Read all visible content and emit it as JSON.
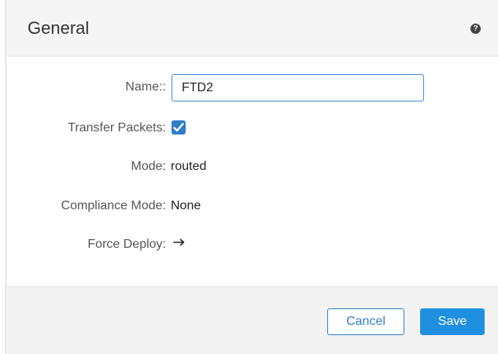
{
  "dialog": {
    "title": "General",
    "help_icon": "help-icon"
  },
  "form": {
    "name_label": "Name::",
    "name_value": "FTD2",
    "transfer_packets_label": "Transfer Packets:",
    "transfer_packets_checked": true,
    "mode_label": "Mode:",
    "mode_value": "routed",
    "compliance_mode_label": "Compliance Mode:",
    "compliance_mode_value": "None",
    "force_deploy_label": "Force Deploy:",
    "force_deploy_icon": "arrow-right-icon"
  },
  "footer": {
    "cancel_label": "Cancel",
    "save_label": "Save"
  },
  "colors": {
    "accent": "#1f8fe0",
    "checkbox": "#2f7fc8",
    "header_bg": "#f5f5f5",
    "footer_bg": "#f3f3f3"
  }
}
